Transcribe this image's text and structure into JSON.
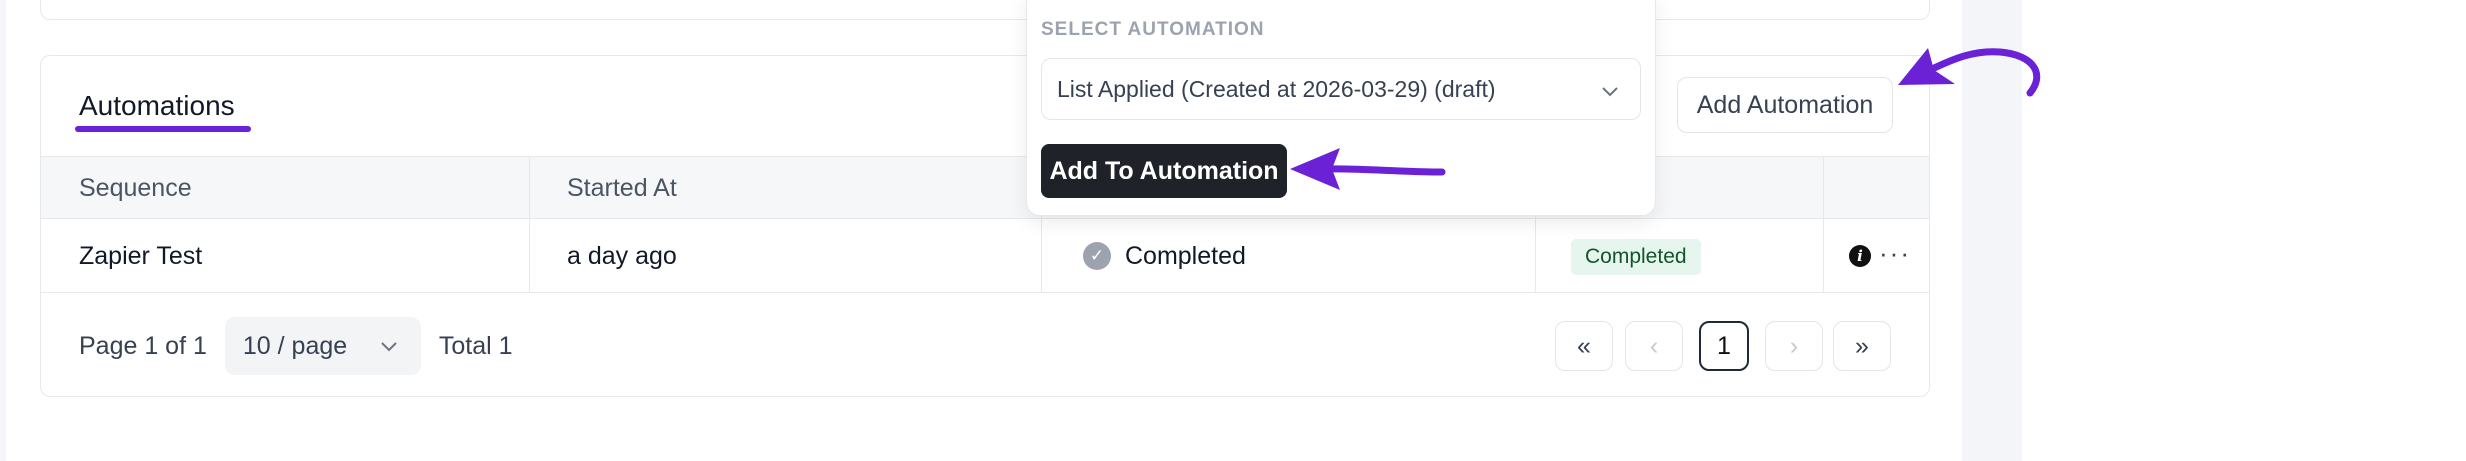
{
  "card": {
    "title": "Automations",
    "add_automation_label": "Add Automation"
  },
  "table": {
    "columns": [
      "Sequence",
      "Started At",
      "",
      "",
      ""
    ],
    "rows": [
      {
        "sequence": "Zapier Test",
        "started_at": "a day ago",
        "status": "Completed",
        "badge": "Completed"
      }
    ]
  },
  "pagination": {
    "page_info": "Page 1 of 1",
    "page_size": "10 / page",
    "total": "Total 1",
    "current_page": "1"
  },
  "popover": {
    "label": "SELECT AUTOMATION",
    "selected": "List Applied (Created at 2026-03-29) (draft)",
    "button_label": "Add To Automation"
  },
  "colors": {
    "annotation_arrow": "#6b21d6",
    "badge_bg": "#e6f6ee",
    "primary_button": "#1f2329"
  },
  "icons": [
    "check-circle-icon",
    "info-icon",
    "more-icon",
    "chevron-down-icon",
    "first-page-icon",
    "prev-page-icon",
    "next-page-icon",
    "last-page-icon"
  ]
}
